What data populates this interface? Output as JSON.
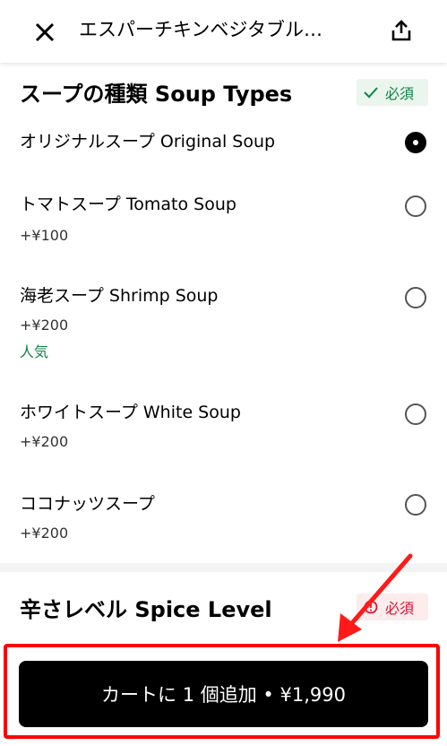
{
  "header": {
    "title": "エスパーチキンベジタブル…",
    "close_icon": "close-icon",
    "share_icon": "share-icon"
  },
  "soup_section": {
    "title": "スープの種類 Soup Types",
    "badge": "必須",
    "badge_icon": "check-icon",
    "options": [
      {
        "label": "オリジナルスープ Original Soup",
        "price": "",
        "tag": "",
        "selected": true
      },
      {
        "label": "トマトスープ Tomato Soup",
        "price": "+¥100",
        "tag": "",
        "selected": false
      },
      {
        "label": "海老スープ Shrimp Soup",
        "price": "+¥200",
        "tag": "人気",
        "selected": false
      },
      {
        "label": "ホワイトスープ White Soup",
        "price": "+¥200",
        "tag": "",
        "selected": false
      },
      {
        "label": "ココナッツスープ",
        "price": "+¥200",
        "tag": "",
        "selected": false
      }
    ]
  },
  "spice_section": {
    "title": "辛さレベル Spice Level",
    "badge": "必須",
    "badge_icon": "alert-icon"
  },
  "footer": {
    "add_to_cart": "カートに 1 個追加 • ¥1,990"
  },
  "colors": {
    "required_ok": "#0e8345",
    "required_warn": "#de1135",
    "highlight": "#ff0000"
  }
}
